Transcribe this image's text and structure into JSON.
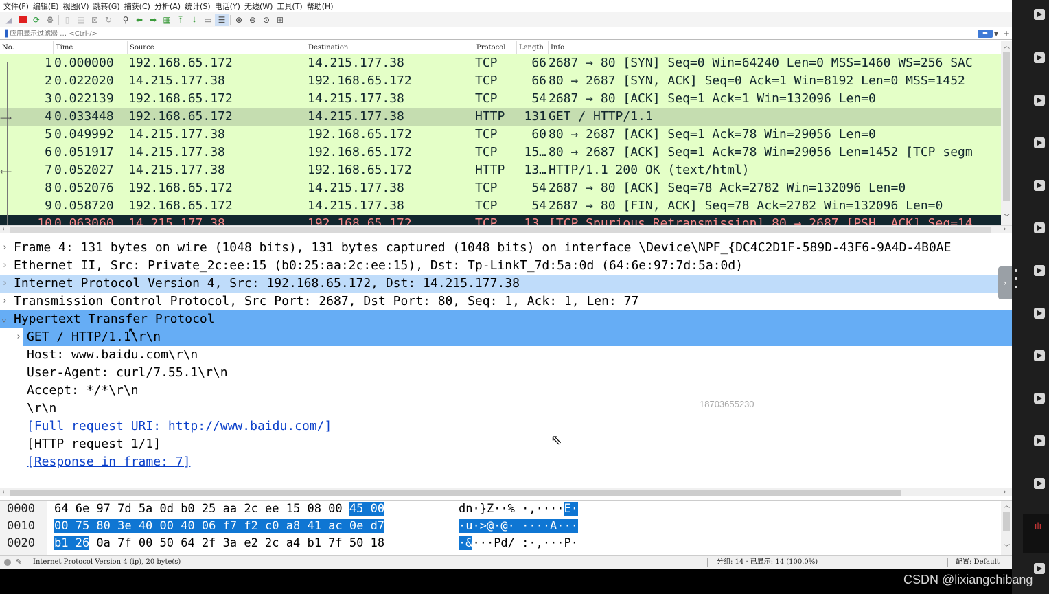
{
  "menu": [
    "文件(F)",
    "编辑(E)",
    "视图(V)",
    "跳转(G)",
    "捕获(C)",
    "分析(A)",
    "统计(S)",
    "电话(Y)",
    "无线(W)",
    "工具(T)",
    "帮助(H)"
  ],
  "toolbar_icons": [
    "shark-fin-icon",
    "stop-icon",
    "restart-icon",
    "options-icon",
    "open-icon",
    "save-icon",
    "close-file-icon",
    "reload-icon",
    "find-icon",
    "back-icon",
    "forward-icon",
    "goto-icon",
    "first-icon",
    "last-icon",
    "autoscroll-icon",
    "colorize-icon",
    "zoom-in-icon",
    "zoom-out-icon",
    "zoom-reset-icon",
    "resize-columns-icon"
  ],
  "filter": {
    "placeholder": "应用显示过滤器 … <Ctrl-/>",
    "plus": "+"
  },
  "packet_list": {
    "columns": [
      "No.",
      "Time",
      "Source",
      "Destination",
      "Protocol",
      "Length",
      "Info"
    ],
    "rows": [
      {
        "no": "1",
        "time": "0.000000",
        "src": "192.168.65.172",
        "dst": "14.215.177.38",
        "proto": "TCP",
        "len": "66",
        "info": "2687 → 80 [SYN] Seq=0 Win=64240 Len=0 MSS=1460 WS=256 SAC"
      },
      {
        "no": "2",
        "time": "0.022020",
        "src": "14.215.177.38",
        "dst": "192.168.65.172",
        "proto": "TCP",
        "len": "66",
        "info": "80 → 2687 [SYN, ACK] Seq=0 Ack=1 Win=8192 Len=0 MSS=1452"
      },
      {
        "no": "3",
        "time": "0.022139",
        "src": "192.168.65.172",
        "dst": "14.215.177.38",
        "proto": "TCP",
        "len": "54",
        "info": "2687 → 80 [ACK] Seq=1 Ack=1 Win=132096 Len=0"
      },
      {
        "no": "4",
        "time": "0.033448",
        "src": "192.168.65.172",
        "dst": "14.215.177.38",
        "proto": "HTTP",
        "len": "131",
        "info": "GET / HTTP/1.1"
      },
      {
        "no": "5",
        "time": "0.049992",
        "src": "14.215.177.38",
        "dst": "192.168.65.172",
        "proto": "TCP",
        "len": "60",
        "info": "80 → 2687 [ACK] Seq=1 Ack=78 Win=29056 Len=0"
      },
      {
        "no": "6",
        "time": "0.051917",
        "src": "14.215.177.38",
        "dst": "192.168.65.172",
        "proto": "TCP",
        "len": "15…",
        "info": "80 → 2687 [ACK] Seq=1 Ack=78 Win=29056 Len=1452 [TCP segm"
      },
      {
        "no": "7",
        "time": "0.052027",
        "src": "14.215.177.38",
        "dst": "192.168.65.172",
        "proto": "HTTP",
        "len": "13…",
        "info": "HTTP/1.1 200 OK  (text/html)"
      },
      {
        "no": "8",
        "time": "0.052076",
        "src": "192.168.65.172",
        "dst": "14.215.177.38",
        "proto": "TCP",
        "len": "54",
        "info": "2687 → 80 [ACK] Seq=78 Ack=2782 Win=132096 Len=0"
      },
      {
        "no": "9",
        "time": "0.058720",
        "src": "192.168.65.172",
        "dst": "14.215.177.38",
        "proto": "TCP",
        "len": "54",
        "info": "2687 → 80 [FIN, ACK] Seq=78 Ack=2782 Win=132096 Len=0"
      },
      {
        "no": "10",
        "time": "0.063060",
        "src": "14.215.177.38",
        "dst": "192.168.65.172",
        "proto": "TCP",
        "len": "13…",
        "info": "[TCP Spurious Retransmission] 80 → 2687 [PSH, ACK] Seq=14"
      }
    ]
  },
  "details": {
    "frame": "Frame 4: 131 bytes on wire (1048 bits), 131 bytes captured (1048 bits) on interface \\Device\\NPF_{DC4C2D1F-589D-43F6-9A4D-4B0AE",
    "ethernet": "Ethernet II, Src: Private_2c:ee:15 (b0:25:aa:2c:ee:15), Dst: Tp-LinkT_7d:5a:0d (64:6e:97:7d:5a:0d)",
    "ip": "Internet Protocol Version 4, Src: 192.168.65.172, Dst: 14.215.177.38",
    "tcp": "Transmission Control Protocol, Src Port: 2687, Dst Port: 80, Seq: 1, Ack: 1, Len: 77",
    "http": "Hypertext Transfer Protocol",
    "get": "GET / HTTP/1.1\\r\\n",
    "host": "Host: www.baidu.com\\r\\n",
    "ua": "User-Agent: curl/7.55.1\\r\\n",
    "accept": "Accept: */*\\r\\n",
    "crlf": "\\r\\n",
    "full_uri": "[Full request URI: http://www.baidu.com/]",
    "http_req": "[HTTP request 1/1]",
    "response_in": "[Response in frame: 7]"
  },
  "watermark_phone": "18703655230",
  "hex": [
    {
      "offset": "0000",
      "plain": "64 6e 97 7d 5a 0d b0 25  aa 2c ee 15 08 00 ",
      "sel": "45 00",
      "asc_plain": "dn·}Z··% ·,····",
      "asc_sel": "E·"
    },
    {
      "offset": "0010",
      "sel_start": "00 75 80 3e 40 00 40 06  f7 f2 c0 a8 41 ac 0e d7",
      "asc_sel_start": "·u·>@·@· ····A···"
    },
    {
      "offset": "0020",
      "sel_start": "b1 26",
      "plain_end": " 0a 7f 00 50 64 2f  3a e2 2c a4 b1 7f 50 18",
      "asc_sel_start": "·&",
      "asc_plain_end": "···Pd/ :·,···P·"
    }
  ],
  "status": {
    "field": "Internet Protocol Version 4 (ip), 20 byte(s)",
    "counts": "分组: 14 · 已显示: 14 (100.0%)",
    "profile": "配置: Default"
  },
  "watermark": "CSDN @lixiangchibang",
  "colors": {
    "tcp_row": "#e4ffc7",
    "selected_row": "#c5ddb0",
    "tree_highlight": "#66adf5",
    "tree_light": "#bfdcfa",
    "hex_select": "#0f76d3",
    "link": "#0a3fc9"
  }
}
